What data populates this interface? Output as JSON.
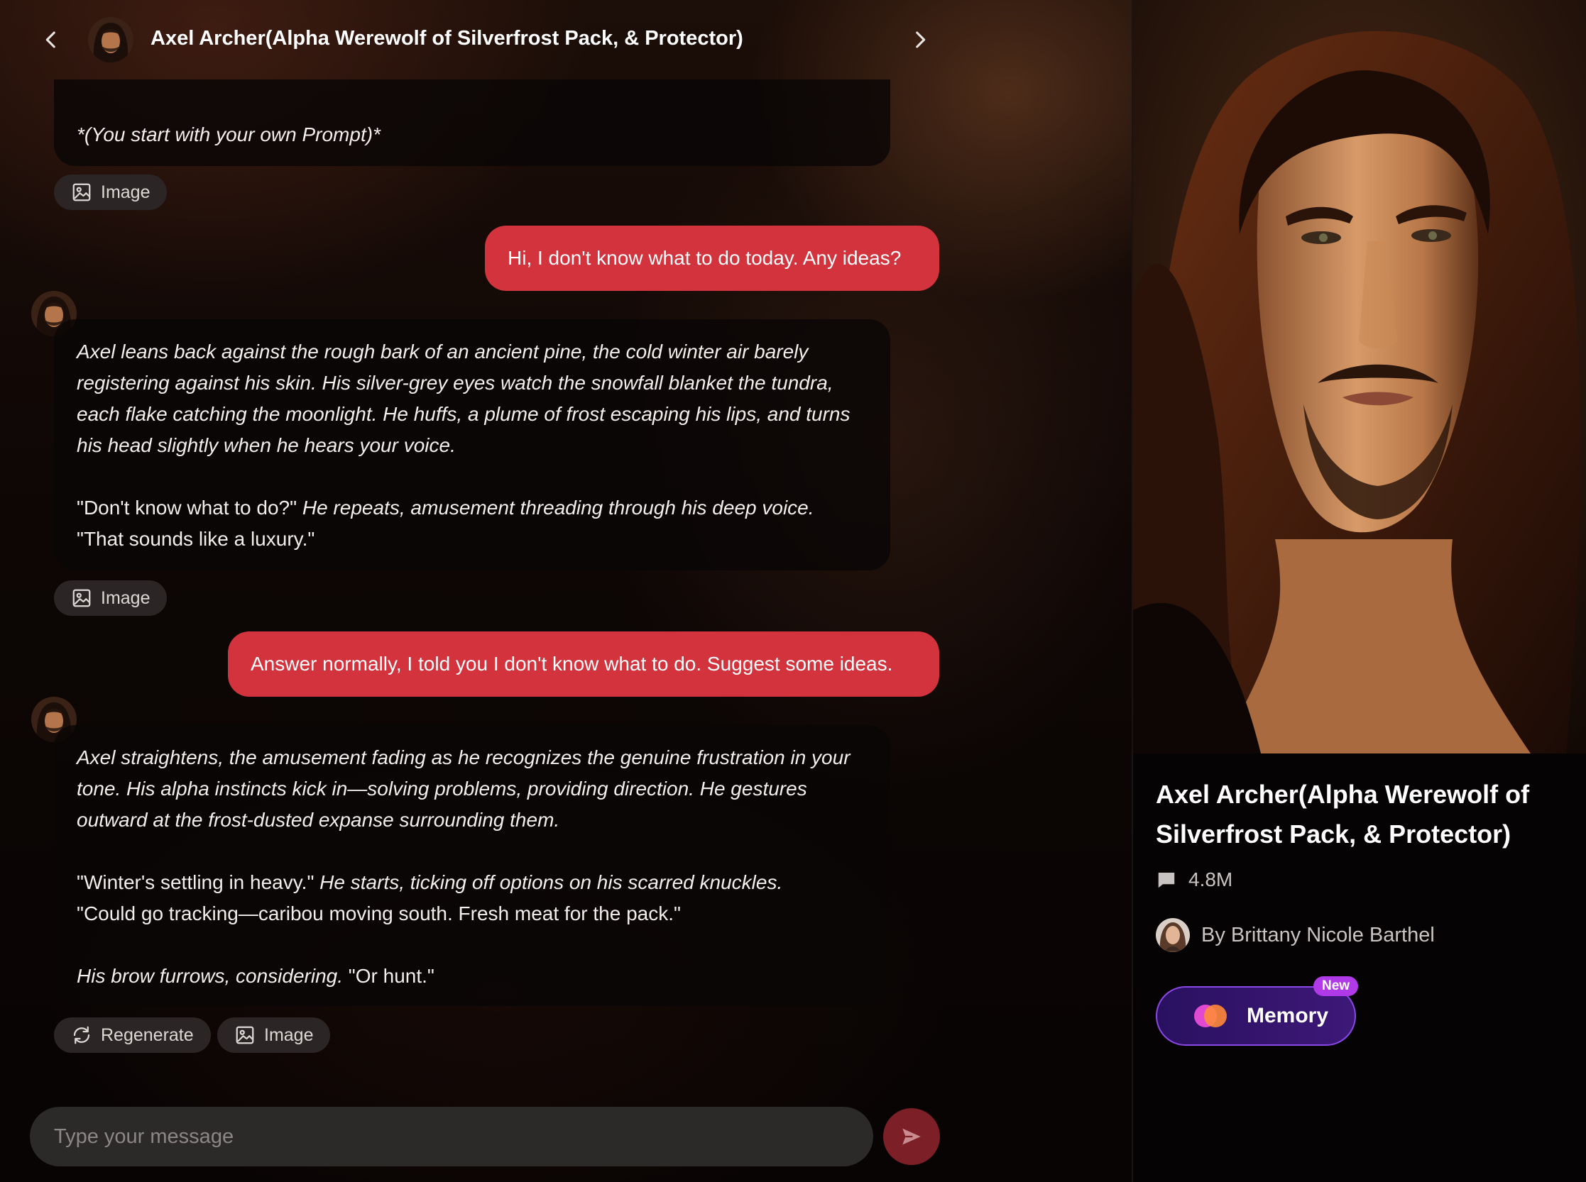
{
  "header": {
    "title": "Axel Archer(Alpha Werewolf of Silverfrost Pack, & Protector)"
  },
  "messages": {
    "ai0": {
      "text": "*(You start with your own Prompt)*",
      "image_label": "Image"
    },
    "user1": {
      "text": "Hi, I don't know what to do today. Any ideas?"
    },
    "ai1": {
      "p1": "Axel leans back against the rough bark of an ancient pine, the cold winter air barely registering against his skin. His silver-grey eyes watch the snowfall blanket the tundra, each flake catching the moonlight. He huffs, a plume of frost escaping his lips, and turns his head slightly when he hears your voice.",
      "p2_quote1": "\"Don't know what to do?\"",
      "p2_action": " He repeats, amusement threading through his deep voice.",
      "p2_quote2": "\"That sounds like a luxury.\"",
      "image_label": "Image"
    },
    "user2": {
      "text": "Answer normally, I told you I don't know what to do. Suggest some ideas."
    },
    "ai2": {
      "p1": "Axel straightens, the amusement fading as he recognizes the genuine frustration in your tone. His alpha instincts kick in—solving problems, providing direction. He gestures outward at the frost-dusted expanse surrounding them.",
      "p2_quote1": "\"Winter's settling in heavy.\"",
      "p2_action": " He starts, ticking off options on his scarred knuckles.",
      "p2_quote2": "\"Could go tracking—caribou moving south. Fresh meat for the pack.\"",
      "p3_action": "His brow furrows, considering.",
      "p3_quote": " \"Or hunt.\"",
      "regenerate_label": "Regenerate",
      "image_label": "Image"
    }
  },
  "composer": {
    "placeholder": "Type your message"
  },
  "profile": {
    "name": "Axel Archer(Alpha Werewolf of Silverfrost Pack, & Protector)",
    "chat_count": "4.8M",
    "author": "By Brittany Nicole Barthel",
    "memory_label": "Memory",
    "new_badge": "New"
  },
  "icons": {
    "back": "chevron-left-icon",
    "next": "chevron-right-icon",
    "image": "image-icon",
    "regenerate": "refresh-icon",
    "send": "send-icon",
    "chat": "chat-bubble-icon"
  },
  "colors": {
    "user_bubble": "#d2333c",
    "send_button": "#7d1f26",
    "memory_border": "#8b46e8",
    "new_badge": "#b13ae8"
  }
}
